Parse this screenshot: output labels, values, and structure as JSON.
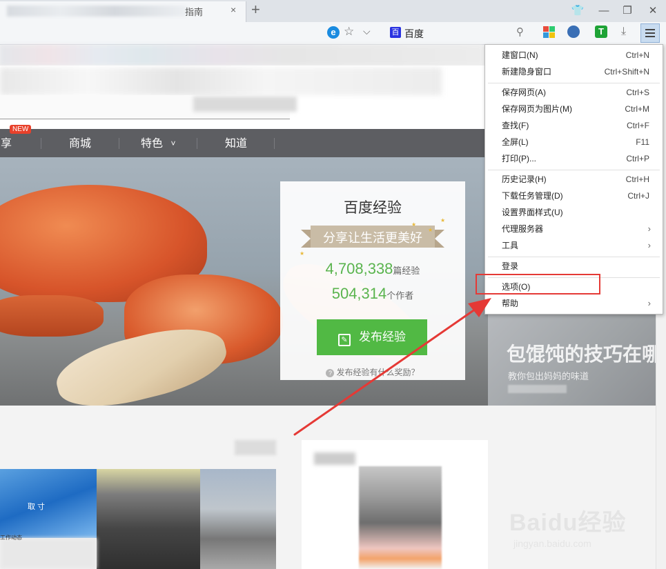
{
  "browser": {
    "tab_title": "指南",
    "tab_close": "×",
    "new_tab": "+",
    "address_site": "百度",
    "baidu_logo_glyph": "百",
    "window_controls": {
      "skin": "👕",
      "minimize": "—",
      "restore": "❐",
      "close": "✕"
    },
    "icons": {
      "ie": "e",
      "star": "☆",
      "chevron": "⌵",
      "search": "⚲",
      "download": "⤓",
      "t_ext": "T"
    }
  },
  "nav": {
    "new_badge": "NEW",
    "items": [
      "享",
      "商城",
      "特色",
      "知道"
    ],
    "dropdown_caret": "˅"
  },
  "hero_card": {
    "title": "百度经验",
    "slogan": "分享让生活更美好",
    "experience_count": "4,708,338",
    "experience_unit": "篇经验",
    "author_count": "504,314",
    "author_unit": "个作者",
    "publish_button": "发布经验",
    "reward_question": "发布经验有什么奖励？",
    "help_glyph": "?",
    "pencil_glyph": "✎"
  },
  "side_hero": {
    "title": "包馄饨的技巧在哪",
    "subtitle": "教你包出妈妈的味道"
  },
  "lower": {
    "left_text_1": "取 寸",
    "left_text_2": "工作动态"
  },
  "watermark": {
    "text": "Baidu经验",
    "url": "jingyan.baidu.com"
  },
  "menu": {
    "groups": [
      [
        {
          "label": "建窗口(N)",
          "shortcut": "Ctrl+N"
        },
        {
          "label": "新建隐身窗口",
          "shortcut": "Ctrl+Shift+N"
        }
      ],
      [
        {
          "label": "保存网页(A)",
          "shortcut": "Ctrl+S"
        },
        {
          "label": "保存网页为图片(M)",
          "shortcut": "Ctrl+M"
        },
        {
          "label": "查找(F)",
          "shortcut": "Ctrl+F"
        },
        {
          "label": "全屏(L)",
          "shortcut": "F11"
        },
        {
          "label": "打印(P)...",
          "shortcut": "Ctrl+P"
        }
      ],
      [
        {
          "label": "历史记录(H)",
          "shortcut": "Ctrl+H"
        },
        {
          "label": "下载任务管理(D)",
          "shortcut": "Ctrl+J"
        },
        {
          "label": "设置界面样式(U)",
          "shortcut": ""
        },
        {
          "label": "代理服务器",
          "shortcut": "",
          "submenu": true
        },
        {
          "label": "工具",
          "shortcut": "",
          "submenu": true
        }
      ],
      [
        {
          "label": "登录",
          "shortcut": ""
        }
      ],
      [
        {
          "label": "选项(O)",
          "shortcut": "",
          "highlighted": true
        },
        {
          "label": "帮助",
          "shortcut": "",
          "submenu": true
        }
      ]
    ],
    "submenu_glyph": "›"
  },
  "colors": {
    "highlight_box": "#e53935",
    "annotation_arrow": "#e53935",
    "accent_green": "#51b944",
    "nav_bar": "#5d5e62"
  }
}
